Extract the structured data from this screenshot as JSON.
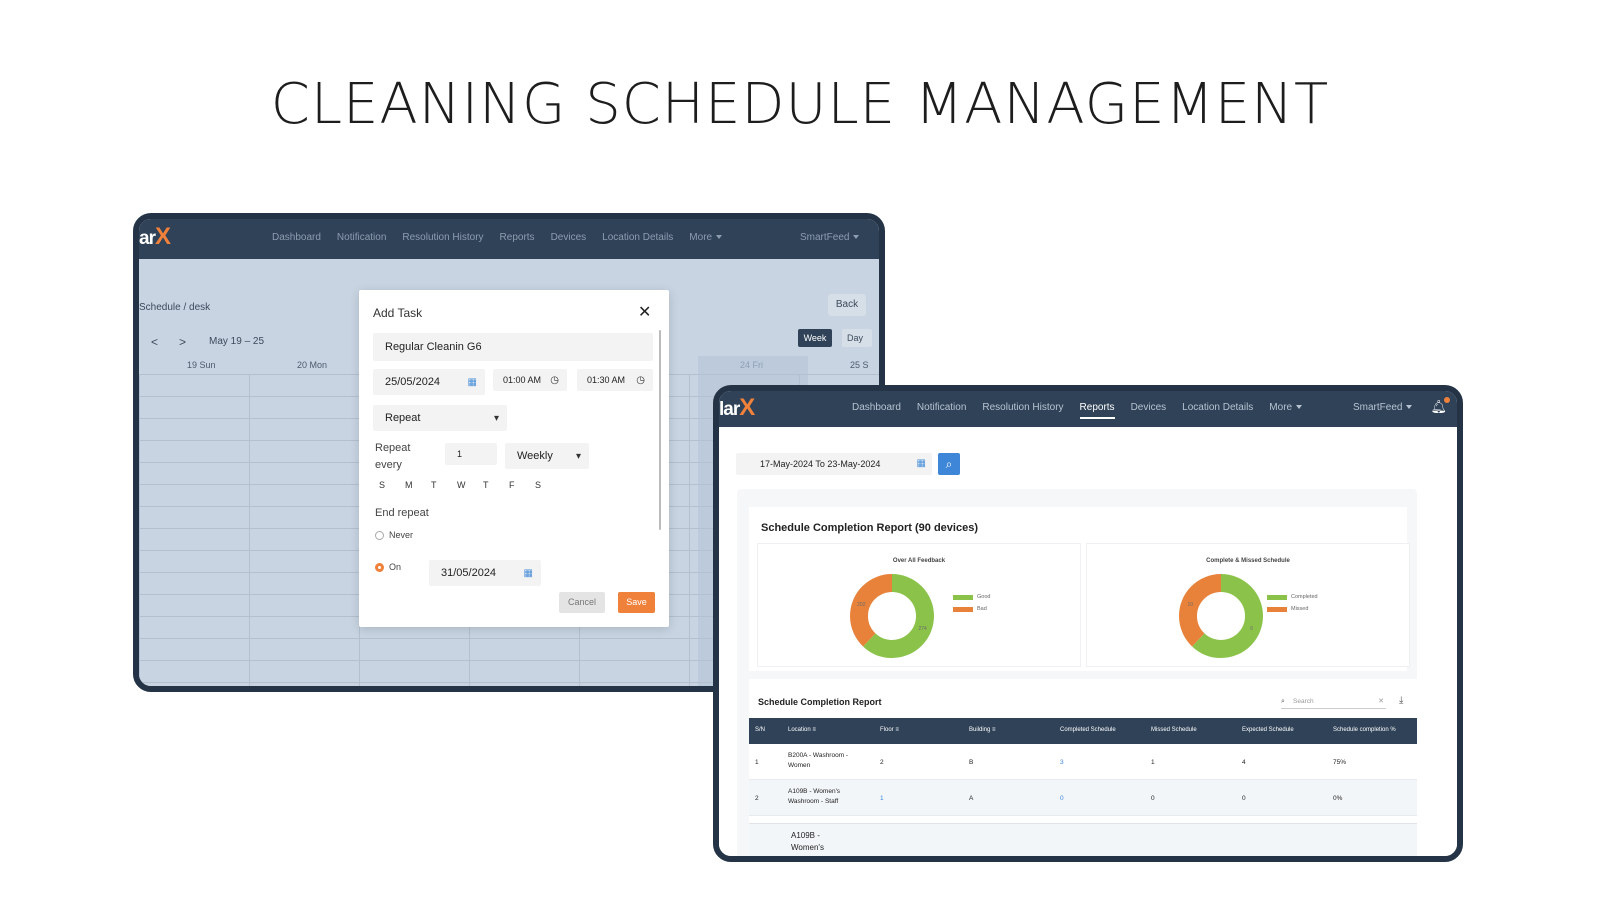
{
  "page_title": "CLEANING SCHEDULE MANAGEMENT",
  "brand": {
    "logo_text": "lar",
    "logo_x": "X",
    "logo_text_left": "ar",
    "accent": "#f0813a",
    "nav_bg": "#2f4258"
  },
  "left_screen": {
    "nav": {
      "items": [
        "Dashboard",
        "Notification",
        "Resolution History",
        "Reports",
        "Devices",
        "Location Details",
        "More"
      ],
      "user": "SmartFeed"
    },
    "breadcrumb": "Schedule / desk",
    "back_label": "Back",
    "prev_label": "<",
    "next_label": ">",
    "range_label": "May 19 – 25",
    "week_label": "Week",
    "day_label": "Day",
    "columns": [
      "19 Sun",
      "20 Mon",
      "24 Fri",
      "25 S"
    ],
    "modal": {
      "title": "Add Task",
      "task_name": "Regular Cleanin G6",
      "date": "25/05/2024",
      "start_time": "01:00 AM",
      "end_time": "01:30 AM",
      "repeat_select": "Repeat",
      "repeat_every_label": "Repeat every",
      "repeat_every_value": "1",
      "repeat_unit": "Weekly",
      "days": [
        "S",
        "M",
        "T",
        "W",
        "T",
        "F",
        "S"
      ],
      "end_repeat_label": "End repeat",
      "never_label": "Never",
      "on_label": "On",
      "end_date": "31/05/2024",
      "cancel_label": "Cancel",
      "save_label": "Save"
    }
  },
  "right_screen": {
    "nav": {
      "items": [
        "Dashboard",
        "Notification",
        "Resolution History",
        "Reports",
        "Devices",
        "Location Details",
        "More"
      ],
      "active": "Reports",
      "user": "SmartFeed"
    },
    "date_range": "17-May-2024 To 23-May-2024",
    "report_title": "Schedule Completion Report (90 devices)",
    "charts": [
      {
        "title": "Over All Feedback",
        "legend": [
          "Good",
          "Bad"
        ],
        "colors": [
          "#8bc34a",
          "#e8823a"
        ],
        "values": [
          62,
          38
        ],
        "labels": [
          "274",
          "202"
        ]
      },
      {
        "title": "Complete & Missed Schedule",
        "legend": [
          "Completed",
          "Missed"
        ],
        "colors": [
          "#8bc34a",
          "#e8823a"
        ],
        "values": [
          62,
          38
        ],
        "labels": [
          "6",
          "10"
        ]
      }
    ],
    "table": {
      "title": "Schedule Completion Report",
      "search_placeholder": "Search",
      "headers": [
        "S/N",
        "Location",
        "Floor",
        "Building",
        "Completed Schedule",
        "Missed Schedule",
        "Expected Schedule",
        "Schedule completion %"
      ],
      "rows": [
        {
          "sn": "1",
          "location": "B200A - Washroom - Women",
          "floor": "2",
          "building": "B",
          "completed": "3",
          "missed": "1",
          "expected": "4",
          "pct": "75%"
        },
        {
          "sn": "2",
          "location": "A109B - Women's Washroom - Staff",
          "floor": "1",
          "building": "A",
          "completed": "0",
          "missed": "0",
          "expected": "0",
          "pct": "0%"
        }
      ],
      "partial_row_location": "A109B - Women's"
    }
  }
}
